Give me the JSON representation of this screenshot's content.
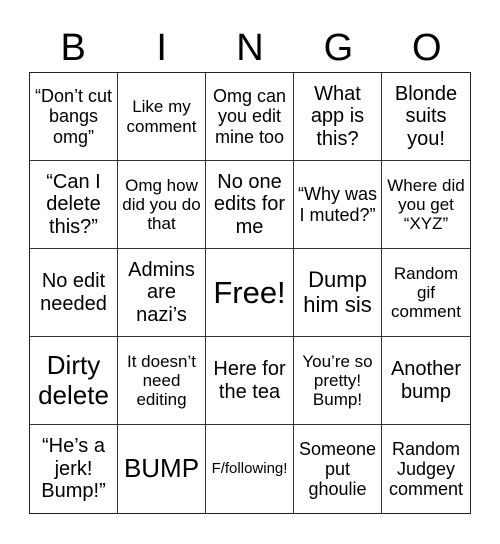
{
  "header": {
    "letters": [
      "B",
      "I",
      "N",
      "G",
      "O"
    ]
  },
  "board": {
    "rows": [
      [
        "“Don’t cut bangs omg”",
        "Like my comment",
        "Omg can you edit mine too",
        "What app is this?",
        "Blonde suits you!"
      ],
      [
        "“Can I delete this?”",
        "Omg how did you do that",
        "No one edits for me",
        "“Why was I muted?”",
        "Where did you get “XYZ”"
      ],
      [
        "No edit needed",
        "Admins are nazi’s",
        "Free!",
        "Dump him sis",
        "Random gif comment"
      ],
      [
        "Dirty delete",
        "It doesn’t need editing",
        "Here for the tea",
        "You’re so pretty! Bump!",
        "Another bump"
      ],
      [
        "“He’s a jerk! Bump!”",
        "BUMP",
        "F/following!",
        "Someone put ghoulie",
        "Random Judgey comment"
      ]
    ]
  }
}
